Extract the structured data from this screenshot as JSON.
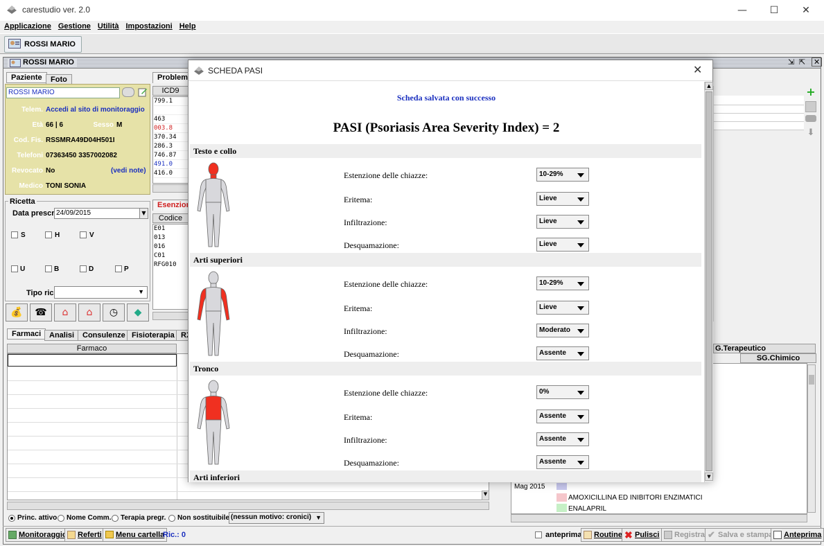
{
  "window": {
    "title": "carestudio ver. 2.0"
  },
  "menu": [
    "Applicazione",
    "Gestione",
    "Utilità",
    "Impostazioni",
    "Help"
  ],
  "patient_tab": "ROSSI MARIO",
  "inner_title": "ROSSI MARIO",
  "left_tabs": [
    "Paziente",
    "Foto"
  ],
  "patient": {
    "name": "ROSSI MARIO",
    "telem_label": "Telem.",
    "telem_value": "Accedi al sito di monitoraggio",
    "eta_label": "Età",
    "eta_value": "66 | 6",
    "sesso_label": "Sesso",
    "sesso_value": "M",
    "codfis_label": "Cod. Fis.",
    "codfis_value": "RSSMRA49D04H501I",
    "telefoni_label": "Telefoni",
    "telefoni_value": "07363450  3357002082",
    "revocato_label": "Revocato",
    "revocato_value": "No",
    "vedi_note": "(vedi note)",
    "medico_label": "Medico",
    "medico_value": "TONI SONIA"
  },
  "ricetta": {
    "title": "Ricetta",
    "data_label": "Data prescr.",
    "data_value": "24/09/2015",
    "checks_row1": [
      "S",
      "H",
      "V"
    ],
    "checks_row2": [
      "U",
      "B",
      "D",
      "P"
    ],
    "tipo_label": "Tipo ric."
  },
  "problemi": {
    "tab": "Problemi",
    "col": "ICD9",
    "rows": [
      {
        "code": "799.1",
        "color": "#000000"
      },
      {
        "code": "",
        "color": "#000000"
      },
      {
        "code": "463",
        "color": "#000000"
      },
      {
        "code": "003.8",
        "color": "#d02020"
      },
      {
        "code": "370.34",
        "color": "#000000"
      },
      {
        "code": "286.3",
        "color": "#000000"
      },
      {
        "code": "746.87",
        "color": "#000000"
      },
      {
        "code": "491.0",
        "color": "#1a2fbf"
      },
      {
        "code": "416.0",
        "color": "#000000"
      }
    ]
  },
  "esenzioni": {
    "tab": "Esenzioni",
    "col": "Codice",
    "rows": [
      "E01",
      "013",
      "016",
      "C01",
      "RFG010"
    ]
  },
  "bottom_tabs": [
    "Farmaci",
    "Analisi",
    "Consulenze",
    "Fisioterapia",
    "RX"
  ],
  "farmaci": {
    "col": "Farmaco"
  },
  "right_panel": {
    "col1": "G.Terapeutico",
    "col2": "SG.Chimico",
    "timeline_label": "Mag 2015",
    "entries": [
      {
        "label": "AMOXICILLINA ED INIBITORI ENZIMATICI",
        "color": "#f5c6cb"
      },
      {
        "label": "ENALAPRIL",
        "color": "#c6f0c6"
      }
    ]
  },
  "radios": {
    "options": [
      "Princ. attivo",
      "Nome Comm.",
      "Terapia pregr.",
      "Non sostituibile"
    ],
    "selected": "Princ. attivo",
    "motivo": "(nessun motivo: cronici)"
  },
  "bottom_bar": {
    "left_buttons": [
      "Monitoraggio",
      "Referti",
      "Menu cartella"
    ],
    "ric_label": "Ric.: 0",
    "anteprima_check": "anteprima",
    "right_buttons": [
      "Routine",
      "Pulisci",
      "Registra",
      "Salva e stampa",
      "Anteprima"
    ]
  },
  "dialog": {
    "title": "SCHEDA PASI",
    "success": "Scheda salvata con successo",
    "heading": "PASI (Psoriasis Area Severity Index) = 2",
    "sections": [
      {
        "name": "Testo e collo",
        "highlight": "head",
        "fields": [
          {
            "label": "Estenzione delle chiazze:",
            "value": "10-29%"
          },
          {
            "label": "Eritema:",
            "value": "Lieve"
          },
          {
            "label": "Infiltrazione:",
            "value": "Lieve"
          },
          {
            "label": "Desquamazione:",
            "value": "Lieve"
          }
        ]
      },
      {
        "name": "Arti superiori",
        "highlight": "arms",
        "fields": [
          {
            "label": "Estenzione delle chiazze:",
            "value": "10-29%"
          },
          {
            "label": "Eritema:",
            "value": "Lieve"
          },
          {
            "label": "Infiltrazione:",
            "value": "Moderato"
          },
          {
            "label": "Desquamazione:",
            "value": "Assente"
          }
        ]
      },
      {
        "name": "Tronco",
        "highlight": "trunk",
        "fields": [
          {
            "label": "Estenzione delle chiazze:",
            "value": "0%"
          },
          {
            "label": "Eritema:",
            "value": "Assente"
          },
          {
            "label": "Infiltrazione:",
            "value": "Assente"
          },
          {
            "label": "Desquamazione:",
            "value": "Assente"
          }
        ]
      },
      {
        "name": "Arti inferiori",
        "highlight": "legs",
        "fields": []
      }
    ]
  },
  "colors": {
    "highlight_red": "#f03020",
    "body_gray": "#d8d8dc",
    "success_blue": "#1a2fbf"
  }
}
